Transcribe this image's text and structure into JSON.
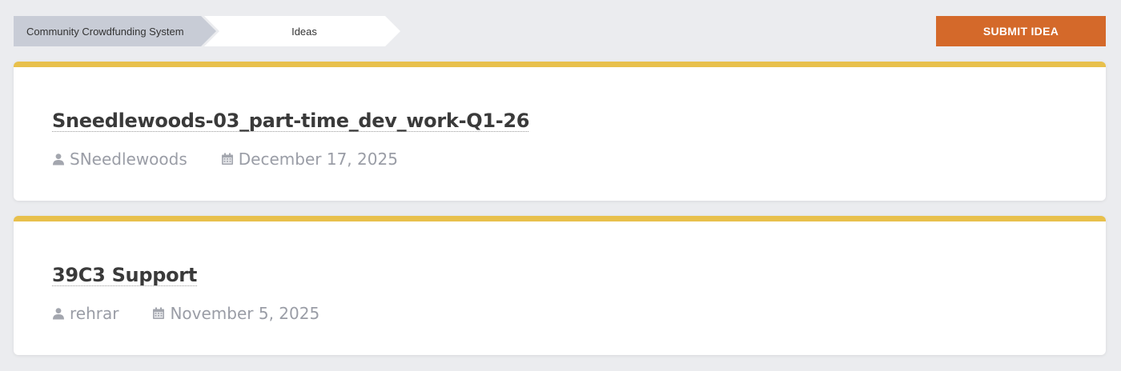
{
  "breadcrumb": {
    "home": "Community Crowdfunding System",
    "current": "Ideas"
  },
  "toolbar": {
    "submit_label": "SUBMIT IDEA"
  },
  "colors": {
    "accent_orange": "#d4692a",
    "card_top_border": "#e8c04c",
    "background": "#ebecef"
  },
  "ideas": [
    {
      "title": "Sneedlewoods-03_part-time_dev_work-Q1-26",
      "author": "SNeedlewoods",
      "date": "December 17, 2025",
      "author_icon": "user-icon",
      "date_icon": "calendar-icon"
    },
    {
      "title": "39C3 Support",
      "author": "rehrar",
      "date": "November 5, 2025",
      "author_icon": "user-icon",
      "date_icon": "calendar-icon"
    }
  ]
}
